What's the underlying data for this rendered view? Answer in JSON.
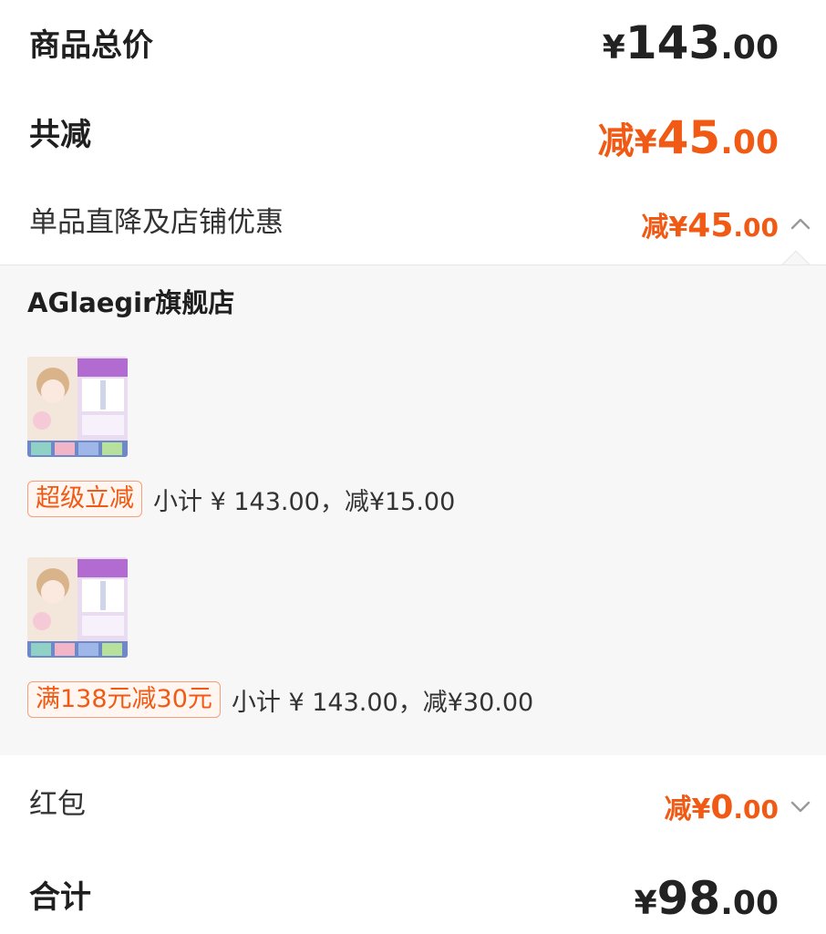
{
  "summary": {
    "total_label": "商品总价",
    "total_price": {
      "yen": "¥",
      "int": "143",
      "dec": ".00"
    },
    "discount_label": "共减",
    "discount_price": {
      "prefix": "减",
      "yen": "¥",
      "int": "45",
      "dec": ".00"
    },
    "store_discount_label": "单品直降及店铺优惠",
    "store_discount_price": {
      "prefix": "减¥",
      "int": "45",
      "dec": ".00"
    },
    "red_packet_label": "红包",
    "red_packet_price": {
      "prefix": "减¥",
      "int": "0",
      "dec": ".00"
    },
    "final_label": "合计",
    "final_price": {
      "yen": "¥",
      "int": "98",
      "dec": ".00"
    }
  },
  "detail": {
    "store_name": "AGlaegir旗舰店",
    "items": [
      {
        "tag": "超级立减",
        "text": "小计 ¥ 143.00，减¥15.00"
      },
      {
        "tag": "满138元减30元",
        "text": "小计 ¥ 143.00，减¥30.00"
      }
    ]
  },
  "icons": {
    "expanded_chevron": "chevron-up-icon",
    "collapsed_chevron": "chevron-down-icon"
  },
  "colors": {
    "accent": "#f05a14",
    "panel_bg": "#f7f7f7"
  }
}
